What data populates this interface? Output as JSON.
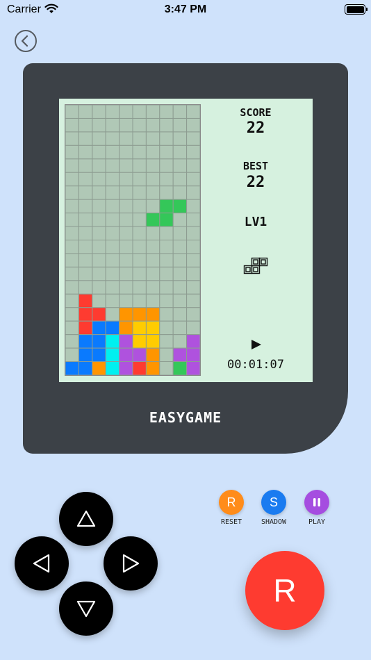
{
  "status_bar": {
    "carrier": "Carrier",
    "time": "3:47 PM"
  },
  "game": {
    "score_label": "SCORE",
    "score": "22",
    "best_label": "BEST",
    "best": "22",
    "level": "LV1",
    "timer": "00:01:07",
    "next_piece": "Z",
    "board_cols": 10,
    "board_rows": 20,
    "falling_piece": [
      [
        6,
        8,
        "green"
      ],
      [
        7,
        8,
        "green"
      ],
      [
        7,
        7,
        "green"
      ],
      [
        8,
        7,
        "green"
      ]
    ],
    "locked_cells": [
      [
        1,
        14,
        "red"
      ],
      [
        1,
        15,
        "red"
      ],
      [
        2,
        15,
        "red"
      ],
      [
        4,
        15,
        "orange"
      ],
      [
        5,
        15,
        "orange"
      ],
      [
        6,
        15,
        "orange"
      ],
      [
        1,
        16,
        "red"
      ],
      [
        2,
        16,
        "blue"
      ],
      [
        3,
        16,
        "blue"
      ],
      [
        4,
        16,
        "orange"
      ],
      [
        5,
        16,
        "yellow"
      ],
      [
        6,
        16,
        "yellow"
      ],
      [
        1,
        17,
        "blue"
      ],
      [
        2,
        17,
        "blue"
      ],
      [
        3,
        17,
        "cyan"
      ],
      [
        4,
        17,
        "purple"
      ],
      [
        5,
        17,
        "yellow"
      ],
      [
        6,
        17,
        "yellow"
      ],
      [
        9,
        17,
        "purple"
      ],
      [
        1,
        18,
        "blue"
      ],
      [
        2,
        18,
        "blue"
      ],
      [
        3,
        18,
        "cyan"
      ],
      [
        4,
        18,
        "purple"
      ],
      [
        5,
        18,
        "purple"
      ],
      [
        6,
        18,
        "orange"
      ],
      [
        8,
        18,
        "purple"
      ],
      [
        9,
        18,
        "purple"
      ],
      [
        0,
        19,
        "blue"
      ],
      [
        1,
        19,
        "blue"
      ],
      [
        2,
        19,
        "orange"
      ],
      [
        3,
        19,
        "cyan"
      ],
      [
        4,
        19,
        "purple"
      ],
      [
        5,
        19,
        "red"
      ],
      [
        6,
        19,
        "orange"
      ],
      [
        8,
        19,
        "green"
      ],
      [
        9,
        19,
        "purple"
      ]
    ]
  },
  "brand": "EASYGAME",
  "controls": {
    "reset_letter": "R",
    "reset_label": "RESET",
    "shadow_letter": "S",
    "shadow_label": "SHADOW",
    "play_label": "PLAY",
    "rotate_letter": "R"
  },
  "colors": {
    "background": "#cfe2fb",
    "console": "#3c4147",
    "screen": "#d6f1df",
    "empty_cell": "#b0c8b6",
    "red": "#fe3b30",
    "orange": "#ff9500",
    "yellow": "#ffcc00",
    "blue": "#0a7afe",
    "cyan": "#00f0f0",
    "purple": "#af52de",
    "green": "#34c759",
    "reset_button": "#ff8c1a",
    "shadow_button": "#1a7bf0",
    "pause_button": "#a54de0",
    "rotate_button": "#fe3b30"
  }
}
